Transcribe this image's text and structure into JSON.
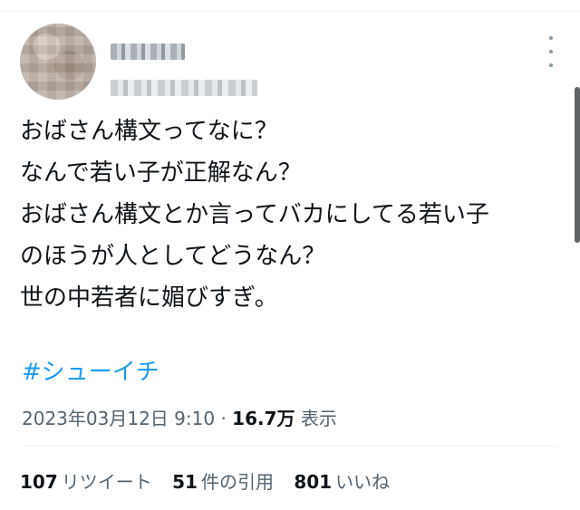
{
  "tweet": {
    "lines": [
      "おばさん構文ってなに？",
      "なんで若い子が正解なん？",
      "おばさん構文とか言ってバカにしてる若い子",
      "のほうが人としてどうなん？",
      "世の中若者に媚びすぎ。"
    ],
    "hashtag": "#シューイチ"
  },
  "meta": {
    "date": "2023年03月12日",
    "time": "9:10",
    "separator": "·",
    "views": "16.7万",
    "views_label": "表示"
  },
  "stats": {
    "retweets": {
      "count": "107",
      "label": "リツイート"
    },
    "quotes": {
      "count": "51",
      "label": "件の引用"
    },
    "likes": {
      "count": "801",
      "label": "いいね"
    }
  },
  "icons": [
    "more-icon"
  ],
  "colors": {
    "link": "#1d9bf0",
    "secondary": "#536471",
    "text": "#0f1419"
  }
}
